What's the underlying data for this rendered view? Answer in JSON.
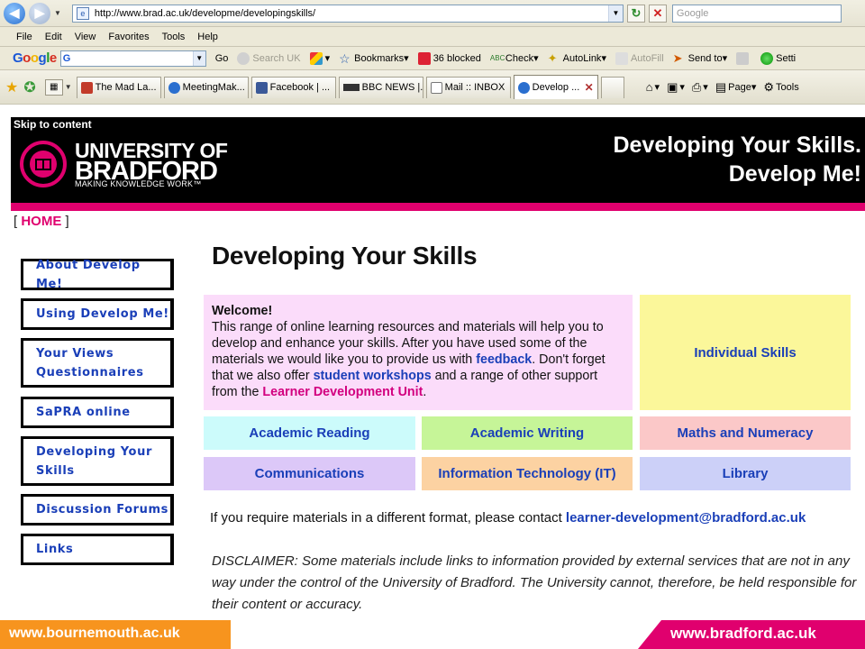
{
  "browser": {
    "address_url": "http://www.brad.ac.uk/developme/developingskills/",
    "search_placeholder": "Google",
    "menu": [
      "File",
      "Edit",
      "View",
      "Favorites",
      "Tools",
      "Help"
    ],
    "google_toolbar": {
      "go": "Go",
      "search_uk": "Search UK",
      "bookmarks": "Bookmarks",
      "blocked": "36 blocked",
      "check": "Check",
      "autolink": "AutoLink",
      "autofill": "AutoFill",
      "send_to": "Send to",
      "settings": "Setti"
    },
    "tabs": [
      {
        "label": "The Mad La...",
        "icon_color": "#c23b2a"
      },
      {
        "label": "MeetingMak...",
        "icon_color": "#2a6fcf"
      },
      {
        "label": "Facebook | ...",
        "icon_color": "#3b5998"
      },
      {
        "label": "BBC NEWS |...",
        "icon_color": "#333333"
      },
      {
        "label": "Mail :: INBOX",
        "icon_color": "#7a7a7a"
      },
      {
        "label": "Develop ...",
        "icon_color": "#2a6fcf",
        "active": true
      }
    ],
    "right_tools": {
      "page": "Page",
      "tools": "Tools"
    }
  },
  "header": {
    "skip": "Skip to content",
    "uni_line1": "UNIVERSITY OF",
    "uni_line2": "BRADFORD",
    "uni_tagline": "MAKING KNOWLEDGE WORK™",
    "title_line1": "Developing Your Skills.",
    "title_line2": "Develop Me!",
    "accent_color": "#e0006e"
  },
  "home": {
    "open": "[ ",
    "label": "HOME",
    "close": " ]"
  },
  "sidebar": [
    {
      "label": "About Develop Me!"
    },
    {
      "label": "Using Develop Me!"
    },
    {
      "label": "Your Views Questionnaires"
    },
    {
      "label": "SaPRA online"
    },
    {
      "label": "Developing Your Skills"
    },
    {
      "label": "Discussion Forums"
    },
    {
      "label": "Links"
    }
  ],
  "main": {
    "heading": "Developing Your Skills",
    "welcome": {
      "title": "Welcome!",
      "text1": "This range of online learning resources and materials will help you to develop and enhance your skills. After you have used some of the materials we would like you to provide us with ",
      "link_feedback": "feedback",
      "text2": ". Don't forget that we also offer ",
      "link_workshops": "student workshops",
      "text3": " and a range of other support from the ",
      "link_ldu": "Learner Development Unit",
      "text4": "."
    },
    "skills": [
      {
        "label": "Individual Skills",
        "color": "#fbf79a"
      },
      {
        "label": "Academic Reading",
        "color": "#ccfbfb"
      },
      {
        "label": "Academic Writing",
        "color": "#c6f598"
      },
      {
        "label": "Maths and Numeracy",
        "color": "#fbc8c8"
      },
      {
        "label": "Communications",
        "color": "#dcc8f8"
      },
      {
        "label": "Information Technology (IT)",
        "color": "#fcd2a2"
      },
      {
        "label": "Library",
        "color": "#ccd0f8"
      }
    ],
    "contact_text": "If you require materials in a different format, please contact ",
    "contact_email": "learner-development@bradford.ac.uk",
    "disclaimer": "DISCLAIMER: Some materials include links to information provided by external services that are not in any way under the control of the University of Bradford. The University cannot, therefore, be held responsible for their content or accuracy."
  },
  "footer": {
    "left_url": "www.bournemouth.ac.uk",
    "right_url": "www.bradford.ac.uk"
  }
}
